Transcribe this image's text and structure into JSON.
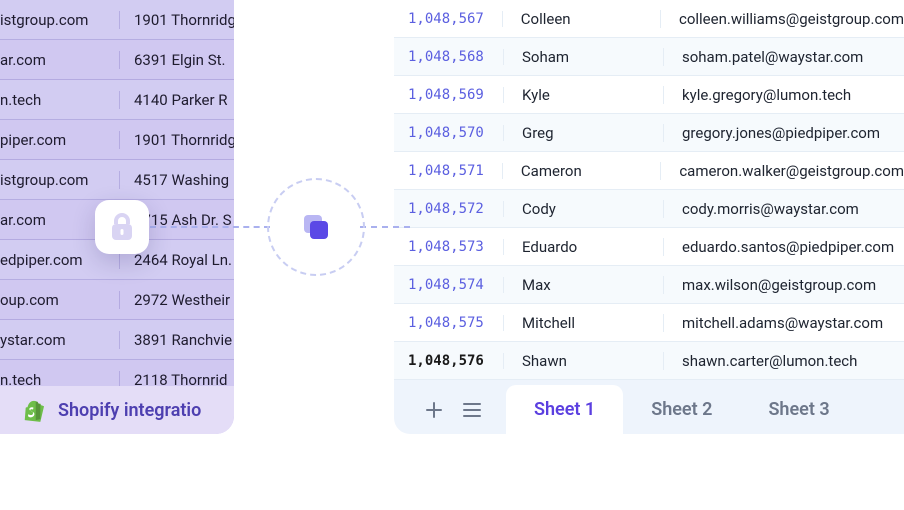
{
  "left": {
    "rows": [
      {
        "email": "istgroup.com",
        "addr": "1901 Thornridg"
      },
      {
        "email": "ar.com",
        "addr": "6391 Elgin St."
      },
      {
        "email": "n.tech",
        "addr": "4140 Parker R"
      },
      {
        "email": "piper.com",
        "addr": "1901 Thornridg"
      },
      {
        "email": "istgroup.com",
        "addr": "4517 Washing"
      },
      {
        "email": "ar.com",
        "addr": "2715 Ash Dr. S"
      },
      {
        "email": "edpiper.com",
        "addr": "2464 Royal Ln."
      },
      {
        "email": "oup.com",
        "addr": "2972 Westheir"
      },
      {
        "email": "ystar.com",
        "addr": "3891 Ranchvie"
      },
      {
        "email": "n.tech",
        "addr": "2118 Thornrid"
      }
    ],
    "footer": "Shopify integratio"
  },
  "right": {
    "rows": [
      {
        "id": "1,048,567",
        "name": "Colleen",
        "email": "colleen.williams@geistgroup.com"
      },
      {
        "id": "1,048,568",
        "name": "Soham",
        "email": "soham.patel@waystar.com"
      },
      {
        "id": "1,048,569",
        "name": "Kyle",
        "email": "kyle.gregory@lumon.tech"
      },
      {
        "id": "1,048,570",
        "name": "Greg",
        "email": "gregory.jones@piedpiper.com"
      },
      {
        "id": "1,048,571",
        "name": "Cameron",
        "email": "cameron.walker@geistgroup.com"
      },
      {
        "id": "1,048,572",
        "name": "Cody",
        "email": "cody.morris@waystar.com"
      },
      {
        "id": "1,048,573",
        "name": "Eduardo",
        "email": "eduardo.santos@piedpiper.com"
      },
      {
        "id": "1,048,574",
        "name": "Max",
        "email": "max.wilson@geistgroup.com"
      },
      {
        "id": "1,048,575",
        "name": "Mitchell",
        "email": "mitchell.adams@waystar.com"
      },
      {
        "id": "1,048,576",
        "name": "Shawn",
        "email": "shawn.carter@lumon.tech",
        "bold": true
      }
    ],
    "tabs": [
      "Sheet 1",
      "Sheet 2",
      "Sheet 3"
    ],
    "active_tab": 0
  },
  "icons": {
    "lock": "lock-icon",
    "copy": "copy-icon",
    "plus": "plus-icon",
    "menu": "menu-icon",
    "shopify": "shopify-icon"
  },
  "colors": {
    "accent": "#5b3fe0",
    "left_bg": "#c9c1ef",
    "tab_bg": "#eef4fc"
  }
}
